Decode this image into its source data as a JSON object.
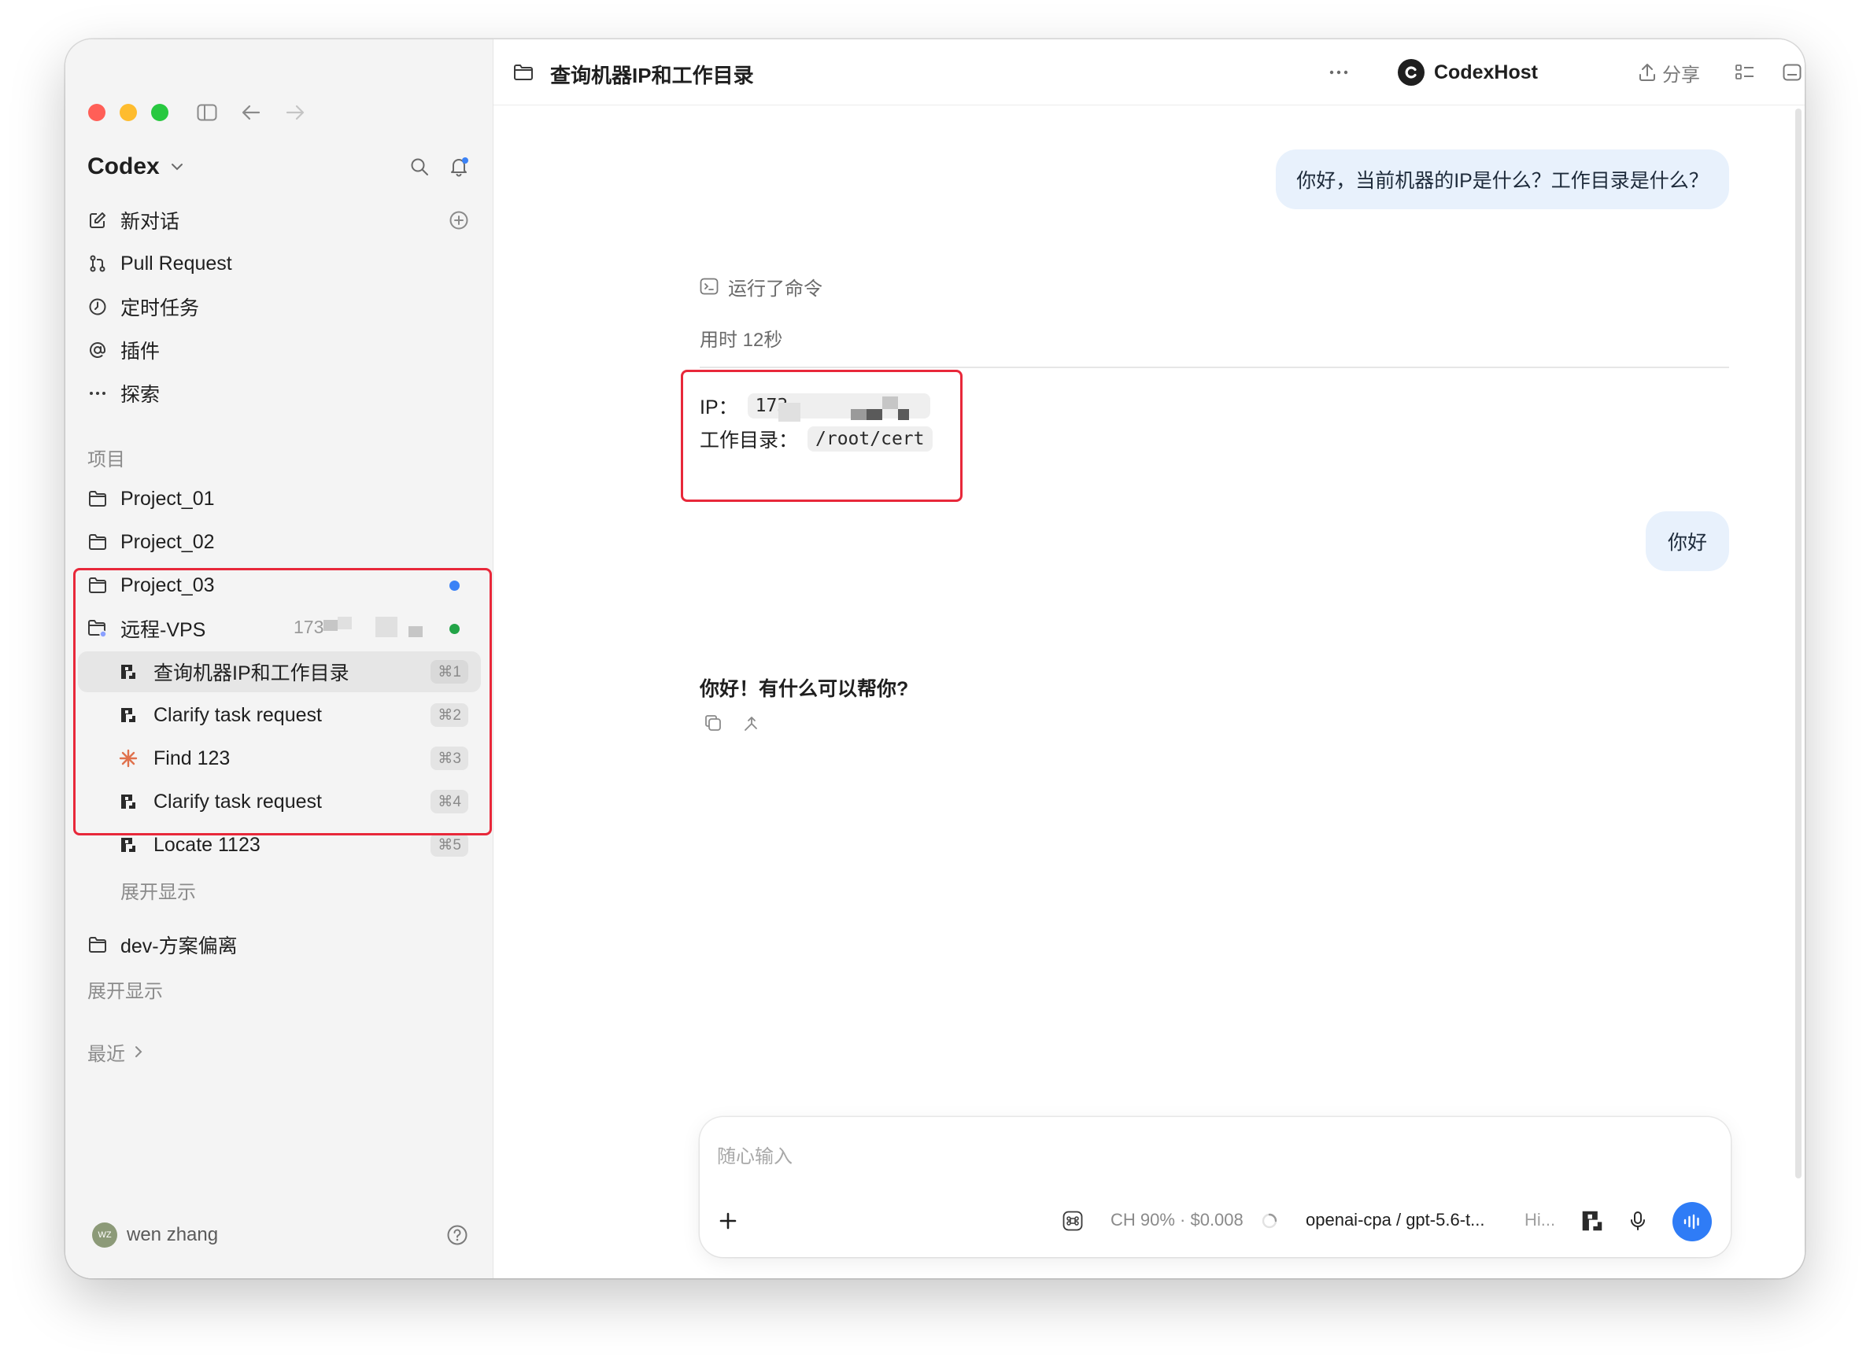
{
  "window": {
    "title_bar": {
      "traffic_lights": [
        "close",
        "minimize",
        "zoom"
      ]
    }
  },
  "sidebar": {
    "app_name": "Codex",
    "nav": [
      {
        "label": "新对话",
        "icon": "edit-icon"
      },
      {
        "label": "Pull Request",
        "icon": "git-pull-request-icon"
      },
      {
        "label": "定时任务",
        "icon": "clock-icon"
      },
      {
        "label": "插件",
        "icon": "at-icon"
      },
      {
        "label": "探索",
        "icon": "ellipsis-icon"
      }
    ],
    "projects_label": "项目",
    "projects": [
      {
        "label": "Project_01",
        "dot": null
      },
      {
        "label": "Project_02",
        "dot": null
      },
      {
        "label": "Project_03",
        "dot": "#3b82f6"
      }
    ],
    "remote": {
      "label": "远程-VPS",
      "host_prefix": "173",
      "status_color": "#22a447",
      "threads": [
        {
          "label": "查询机器IP和工作目录",
          "shortcut": "⌘1",
          "icon": "codex-host-icon",
          "active": true
        },
        {
          "label": "Clarify task request",
          "shortcut": "⌘2",
          "icon": "codex-host-icon",
          "active": false
        },
        {
          "label": "Find 123",
          "shortcut": "⌘3",
          "icon": "sparkle-icon",
          "active": false
        },
        {
          "label": "Clarify task request",
          "shortcut": "⌘4",
          "icon": "codex-host-icon",
          "active": false
        },
        {
          "label": "Locate 1123",
          "shortcut": "⌘5",
          "icon": "codex-host-icon",
          "active": false
        }
      ],
      "expand_label": "展开显示"
    },
    "dev_project": {
      "label": "dev-方案偏离"
    },
    "expand_label_2": "展开显示",
    "recent_label": "最近",
    "user": {
      "initials": "WZ",
      "name": "wen zhang"
    }
  },
  "main": {
    "title": "查询机器IP和工作目录",
    "host_name": "CodexHost",
    "share_label": "分享",
    "messages": {
      "user_1": "你好，当前机器的IP是什么？工作目录是什么？",
      "command_label": "运行了命令",
      "elapsed": "用时 12秒",
      "ip_label": "IP：",
      "ip_prefix": "173",
      "workdir_label": "工作目录：",
      "workdir_value": "/root/cert",
      "user_2": "你好",
      "assistant_reply": "你好！有什么可以帮你?"
    },
    "composer": {
      "placeholder": "随心输入",
      "context_usage": "CH 90% · $0.008",
      "model": "openai-cpa / gpt-5.6-t...",
      "mode": "Hi..."
    }
  },
  "colors": {
    "highlight_box": "#e8283a",
    "send_button": "#2f7cf6",
    "user_bubble": "#e8f1fc"
  }
}
